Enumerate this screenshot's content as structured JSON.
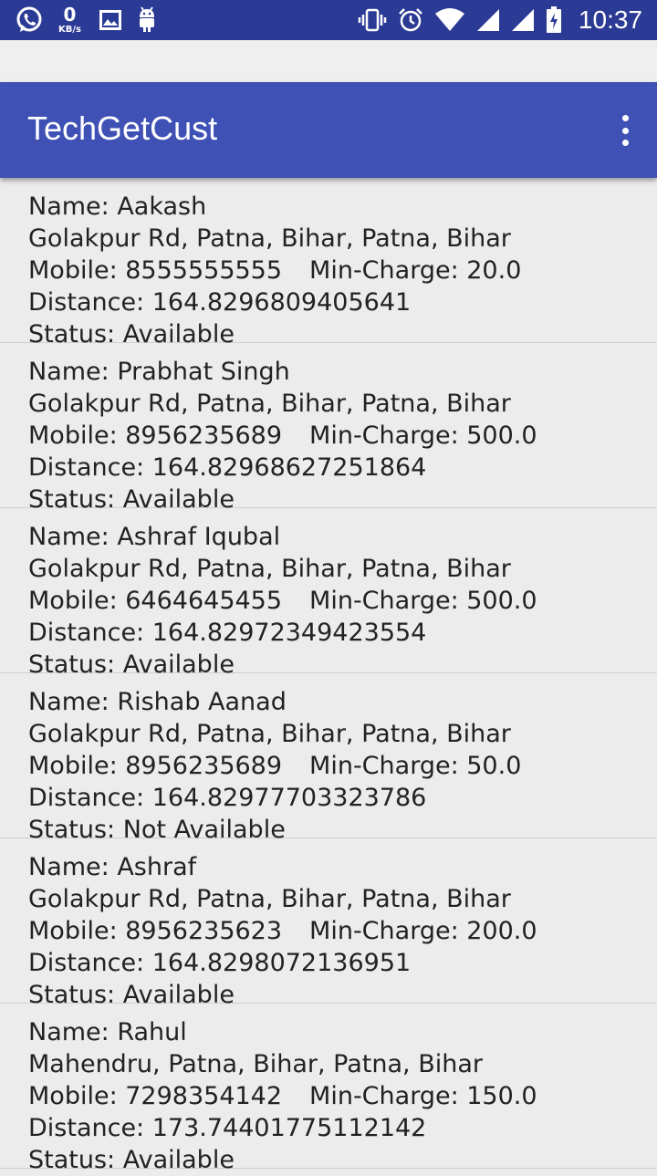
{
  "status_bar": {
    "net_speed_value": "0",
    "net_speed_unit": "KB/s",
    "time": "10:37",
    "left_icons": [
      "whatsapp-icon",
      "image-icon",
      "android-icon"
    ],
    "right_icons": [
      "vibrate-icon",
      "alarm-icon",
      "wifi-icon",
      "signal-icon",
      "signal-icon",
      "battery-charging-icon"
    ]
  },
  "app_bar": {
    "title": "TechGetCust",
    "menu_icon": "more-vert-icon"
  },
  "colors": {
    "status_bar": "#2b3a94",
    "app_bar": "#3f51b5",
    "background": "#ececec"
  },
  "list": {
    "items": [
      {
        "name": "Name: Aakash",
        "address": "Golakpur Rd, Patna, Bihar, Patna, Bihar",
        "mobile": "Mobile: 8555555555",
        "min_charge": "Min-Charge: 20.0",
        "distance": "Distance: 164.8296809405641",
        "status": "Status: Available"
      },
      {
        "name": "Name: Prabhat Singh",
        "address": "Golakpur Rd, Patna, Bihar, Patna, Bihar",
        "mobile": "Mobile: 8956235689",
        "min_charge": "Min-Charge: 500.0",
        "distance": "Distance: 164.82968627251864",
        "status": "Status: Available"
      },
      {
        "name": "Name: Ashraf Iqubal",
        "address": "Golakpur Rd, Patna, Bihar, Patna, Bihar",
        "mobile": "Mobile: 6464645455",
        "min_charge": "Min-Charge: 500.0",
        "distance": "Distance: 164.82972349423554",
        "status": "Status: Available"
      },
      {
        "name": "Name: Rishab Aanad",
        "address": "Golakpur Rd, Patna, Bihar, Patna, Bihar",
        "mobile": "Mobile: 8956235689",
        "min_charge": "Min-Charge: 50.0",
        "distance": "Distance: 164.82977703323786",
        "status": "Status: Not Available"
      },
      {
        "name": "Name: Ashraf",
        "address": "Golakpur Rd, Patna, Bihar, Patna, Bihar",
        "mobile": "Mobile: 8956235623",
        "min_charge": "Min-Charge: 200.0",
        "distance": "Distance: 164.8298072136951",
        "status": "Status: Available"
      },
      {
        "name": "Name: Rahul",
        "address": "Mahendru, Patna, Bihar, Patna, Bihar",
        "mobile": "Mobile: 7298354142",
        "min_charge": "Min-Charge: 150.0",
        "distance": "Distance: 173.74401775112142",
        "status": "Status: Available"
      }
    ]
  }
}
